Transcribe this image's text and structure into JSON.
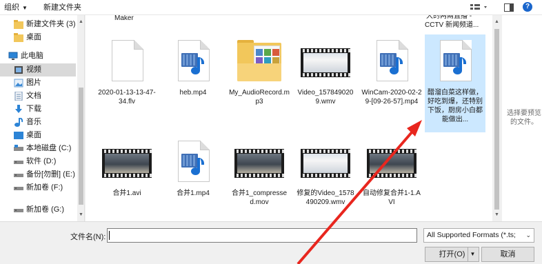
{
  "toolbar": {
    "organize_label": "组织",
    "new_folder_label": "新建文件夹",
    "view_icon": "view-options-icon",
    "preview_pane_icon": "preview-pane-icon",
    "help_icon": "help-icon",
    "help_glyph": "?"
  },
  "sidebar": {
    "items": [
      {
        "label": "新建文件夹 (3)",
        "icon": "folder-icon"
      },
      {
        "label": "桌面",
        "icon": "folder-icon"
      },
      {
        "label": "此电脑",
        "icon": "computer-icon"
      },
      {
        "label": "视频",
        "icon": "video-icon",
        "selected": true
      },
      {
        "label": "图片",
        "icon": "pictures-icon"
      },
      {
        "label": "文档",
        "icon": "documents-icon"
      },
      {
        "label": "下载",
        "icon": "download-icon"
      },
      {
        "label": "音乐",
        "icon": "music-icon"
      },
      {
        "label": "桌面",
        "icon": "desktop-icon"
      },
      {
        "label": "本地磁盘 (C:)",
        "icon": "drive-icon"
      },
      {
        "label": "软件 (D:)",
        "icon": "drive-icon"
      },
      {
        "label": "备份[勿删] (E:)",
        "icon": "drive-icon"
      },
      {
        "label": "新加卷 (F:)",
        "icon": "drive-icon"
      },
      {
        "label": "新加卷 (G:)",
        "icon": "drive-icon"
      }
    ]
  },
  "files": {
    "partial_top_left": "Maker",
    "partial_top_right_1": "大的两兩直播 -",
    "partial_top_right_2": "CCTV 新闻频道...",
    "items": [
      {
        "name": "2020-01-13-13-47-34.flv",
        "icon": "blank-document-icon"
      },
      {
        "name": "heb.mp4",
        "icon": "video-file-icon"
      },
      {
        "name": "My_AudioRecord.mp3",
        "icon": "music-folder-icon"
      },
      {
        "name": "Video_1578490209.wmv",
        "icon": "video-thumbnail"
      },
      {
        "name": "WinCam-2020-02-29-[09-26-57].mp4",
        "icon": "video-file-icon"
      },
      {
        "name": "醋溜白菜这样做，好吃到爆，还特别下饭，厨房小白都能做出...",
        "icon": "video-file-icon",
        "selected": true
      },
      {
        "name": "合并1.avi",
        "icon": "video-thumbnail"
      },
      {
        "name": "合并1.mp4",
        "icon": "video-file-icon"
      },
      {
        "name": "合并1_compressed.mov",
        "icon": "video-thumbnail"
      },
      {
        "name": "修复的Video_1578490209.wmv",
        "icon": "video-thumbnail"
      },
      {
        "name": "自动修复合并1-1.AVI",
        "icon": "video-thumbnail"
      }
    ]
  },
  "preview": {
    "text": "选择要预览的文件。"
  },
  "bottom": {
    "filename_label": "文件名(N):",
    "filename_value": "",
    "format_selected": "All Supported Formats (*.ts;",
    "open_label": "打开(O)",
    "cancel_label": "取消"
  },
  "annotation_color": "#e8261e"
}
